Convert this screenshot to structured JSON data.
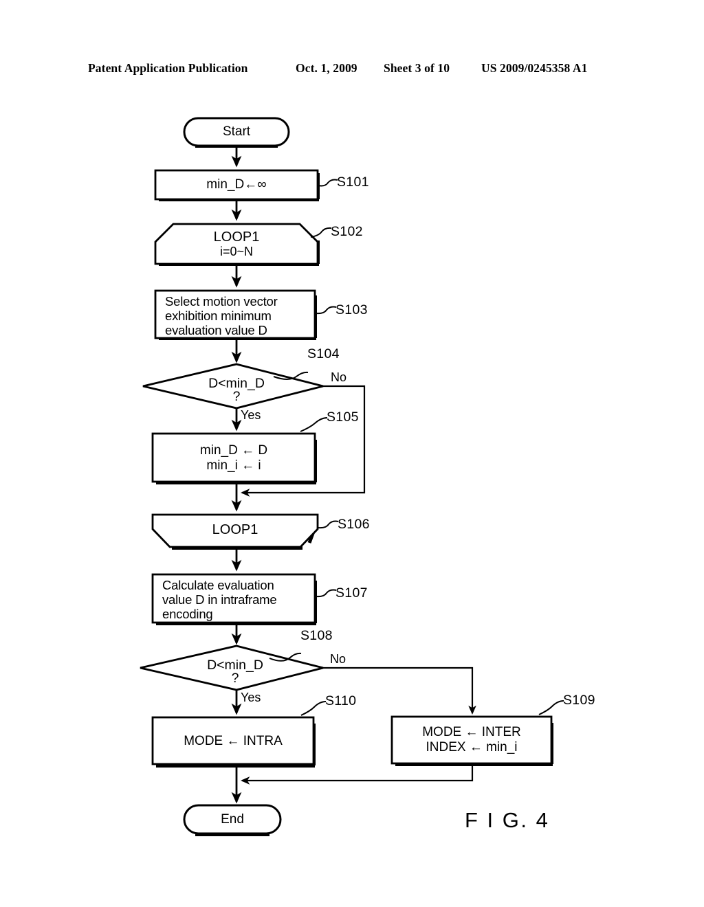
{
  "header": {
    "publication": "Patent Application Publication",
    "date": "Oct. 1, 2009",
    "sheet": "Sheet 3 of 10",
    "patent_number": "US 2009/0245358 A1"
  },
  "figure": {
    "caption": "F I G. 4"
  },
  "flowchart": {
    "type": "flowchart",
    "nodes": [
      {
        "id": "start",
        "shape": "terminal",
        "text": "Start",
        "step": ""
      },
      {
        "id": "s101",
        "shape": "process",
        "text": "min_D←∞",
        "step": "S101"
      },
      {
        "id": "s102",
        "shape": "loop-start",
        "text": "LOOP1",
        "text2": "i=0~N",
        "step": "S102"
      },
      {
        "id": "s103",
        "shape": "process",
        "line1": "Select motion vector",
        "line2": "exhibition minimum",
        "line3": "evaluation value D",
        "step": "S103"
      },
      {
        "id": "s104",
        "shape": "decision",
        "line1": "D<min_D",
        "line2": "?",
        "step": "S104",
        "yes": "Yes",
        "no": "No"
      },
      {
        "id": "s105",
        "shape": "process",
        "line1": "min_D ← D",
        "line2": "min_i ← i",
        "step": "S105"
      },
      {
        "id": "s106",
        "shape": "loop-end",
        "text": "LOOP1",
        "step": "S106"
      },
      {
        "id": "s107",
        "shape": "process",
        "line1": "Calculate evaluation",
        "line2": "value D in intraframe",
        "line3": "encoding",
        "step": "S107"
      },
      {
        "id": "s108",
        "shape": "decision",
        "line1": "D<min_D",
        "line2": "?",
        "step": "S108",
        "yes": "Yes",
        "no": "No"
      },
      {
        "id": "s110",
        "shape": "process",
        "text": "MODE ← INTRA",
        "step": "S110"
      },
      {
        "id": "s109",
        "shape": "process",
        "line1": "MODE ← INTER",
        "line2": "INDEX ← min_i",
        "step": "S109"
      },
      {
        "id": "end",
        "shape": "terminal",
        "text": "End",
        "step": ""
      }
    ],
    "edges": [
      {
        "from": "start",
        "to": "s101"
      },
      {
        "from": "s101",
        "to": "s102"
      },
      {
        "from": "s102",
        "to": "s103"
      },
      {
        "from": "s103",
        "to": "s104"
      },
      {
        "from": "s104",
        "to": "s105",
        "label": "Yes"
      },
      {
        "from": "s104",
        "to": "s106",
        "label": "No"
      },
      {
        "from": "s105",
        "to": "s106"
      },
      {
        "from": "s106",
        "to": "s107"
      },
      {
        "from": "s107",
        "to": "s108"
      },
      {
        "from": "s108",
        "to": "s110",
        "label": "Yes"
      },
      {
        "from": "s108",
        "to": "s109",
        "label": "No"
      },
      {
        "from": "s110",
        "to": "end"
      },
      {
        "from": "s109",
        "to": "end"
      }
    ],
    "colors": {
      "stroke": "#000000",
      "fill": "#ffffff",
      "background": "#ffffff"
    }
  }
}
